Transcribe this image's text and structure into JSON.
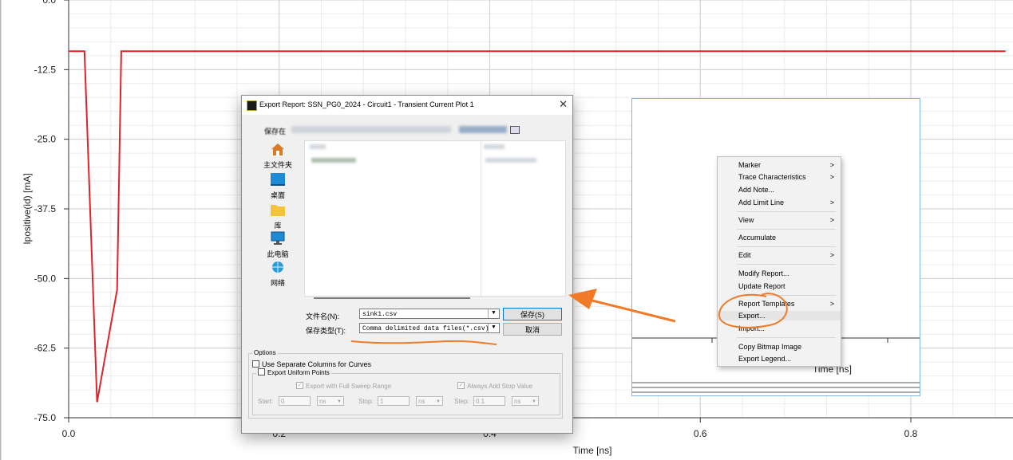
{
  "chart_data": {
    "type": "line",
    "xlabel": "Time [ns]",
    "ylabel": "Ipositive(id) [mA]",
    "xlim": [
      0,
      0.89
    ],
    "ylim": [
      -75,
      0
    ],
    "x_ticks": [
      "0.0",
      "0.2",
      "0.4",
      "0.6",
      "0.8"
    ],
    "x_tick_values": [
      0,
      0.2,
      0.4,
      0.6,
      0.8
    ],
    "y_ticks": [
      "0.0",
      "-12.5",
      "-25.0",
      "-37.5",
      "-50.0",
      "-62.5",
      "-75.0"
    ],
    "y_tick_values": [
      0,
      -12.5,
      -25,
      -37.5,
      -50,
      -62.5,
      -75
    ],
    "grid": true,
    "series": [
      {
        "x": [
          0,
          0.015,
          0.027,
          0.046,
          0.05,
          0.89
        ],
        "y": [
          -9.2,
          -9.2,
          -72.2,
          -52,
          -9.2,
          -9.2
        ],
        "color": "#e0232b"
      }
    ]
  },
  "background_plot": {
    "xlabel": "Time [ns]"
  },
  "dialog": {
    "title": "Export Report: SSN_PG0_2024 - Circuit1 - Transient Current Plot 1",
    "close_glyph": "✕",
    "save_in_label": "保存在",
    "places": [
      "主文件夹",
      "桌面",
      "库",
      "此电脑",
      "网络"
    ],
    "filename_label": "文件名(N):",
    "filename_value": "sink1.csv",
    "filetype_label": "保存类型(T):",
    "filetype_value": "Comma delimited data files(*.csv)",
    "save_button": "保存(S)",
    "cancel_button": "取消",
    "options": {
      "title": "Options",
      "separate_columns": "Use Separate Columns for Curves",
      "export_uniform": "Export Uniform Points",
      "full_sweep": "Export with Full Sweep Range",
      "always_stop": "Always Add Stop Value",
      "start_label": "Start:",
      "start_value": "0",
      "start_unit": "ns",
      "stop_label": "Stop:",
      "stop_value": "1",
      "stop_unit": "ns",
      "step_label": "Step:",
      "step_value": "0.1",
      "step_unit": "ns"
    }
  },
  "context_menu": {
    "items": [
      {
        "label": "Marker",
        "arrow": ">"
      },
      {
        "label": "Trace Characteristics",
        "arrow": ">"
      },
      {
        "label": "Add Note...",
        "arrow": ""
      },
      {
        "label": "Add Limit Line",
        "arrow": ">"
      },
      {
        "label": "View",
        "arrow": ">"
      },
      {
        "label": "Accumulate",
        "arrow": ""
      },
      {
        "label": "Edit",
        "arrow": ">"
      },
      {
        "label": "Modify Report...",
        "arrow": ""
      },
      {
        "label": "Update Report",
        "arrow": ""
      },
      {
        "label": "Report Templates",
        "arrow": ">"
      },
      {
        "label": "Export...",
        "arrow": ""
      },
      {
        "label": "Import...",
        "arrow": ""
      },
      {
        "label": "Copy Bitmap Image",
        "arrow": ""
      },
      {
        "label": "Export Legend...",
        "arrow": ""
      }
    ]
  },
  "colors": {
    "trace": "#e0232b",
    "annotation": "#f07a28",
    "selection_border": "#7fb4e6"
  }
}
